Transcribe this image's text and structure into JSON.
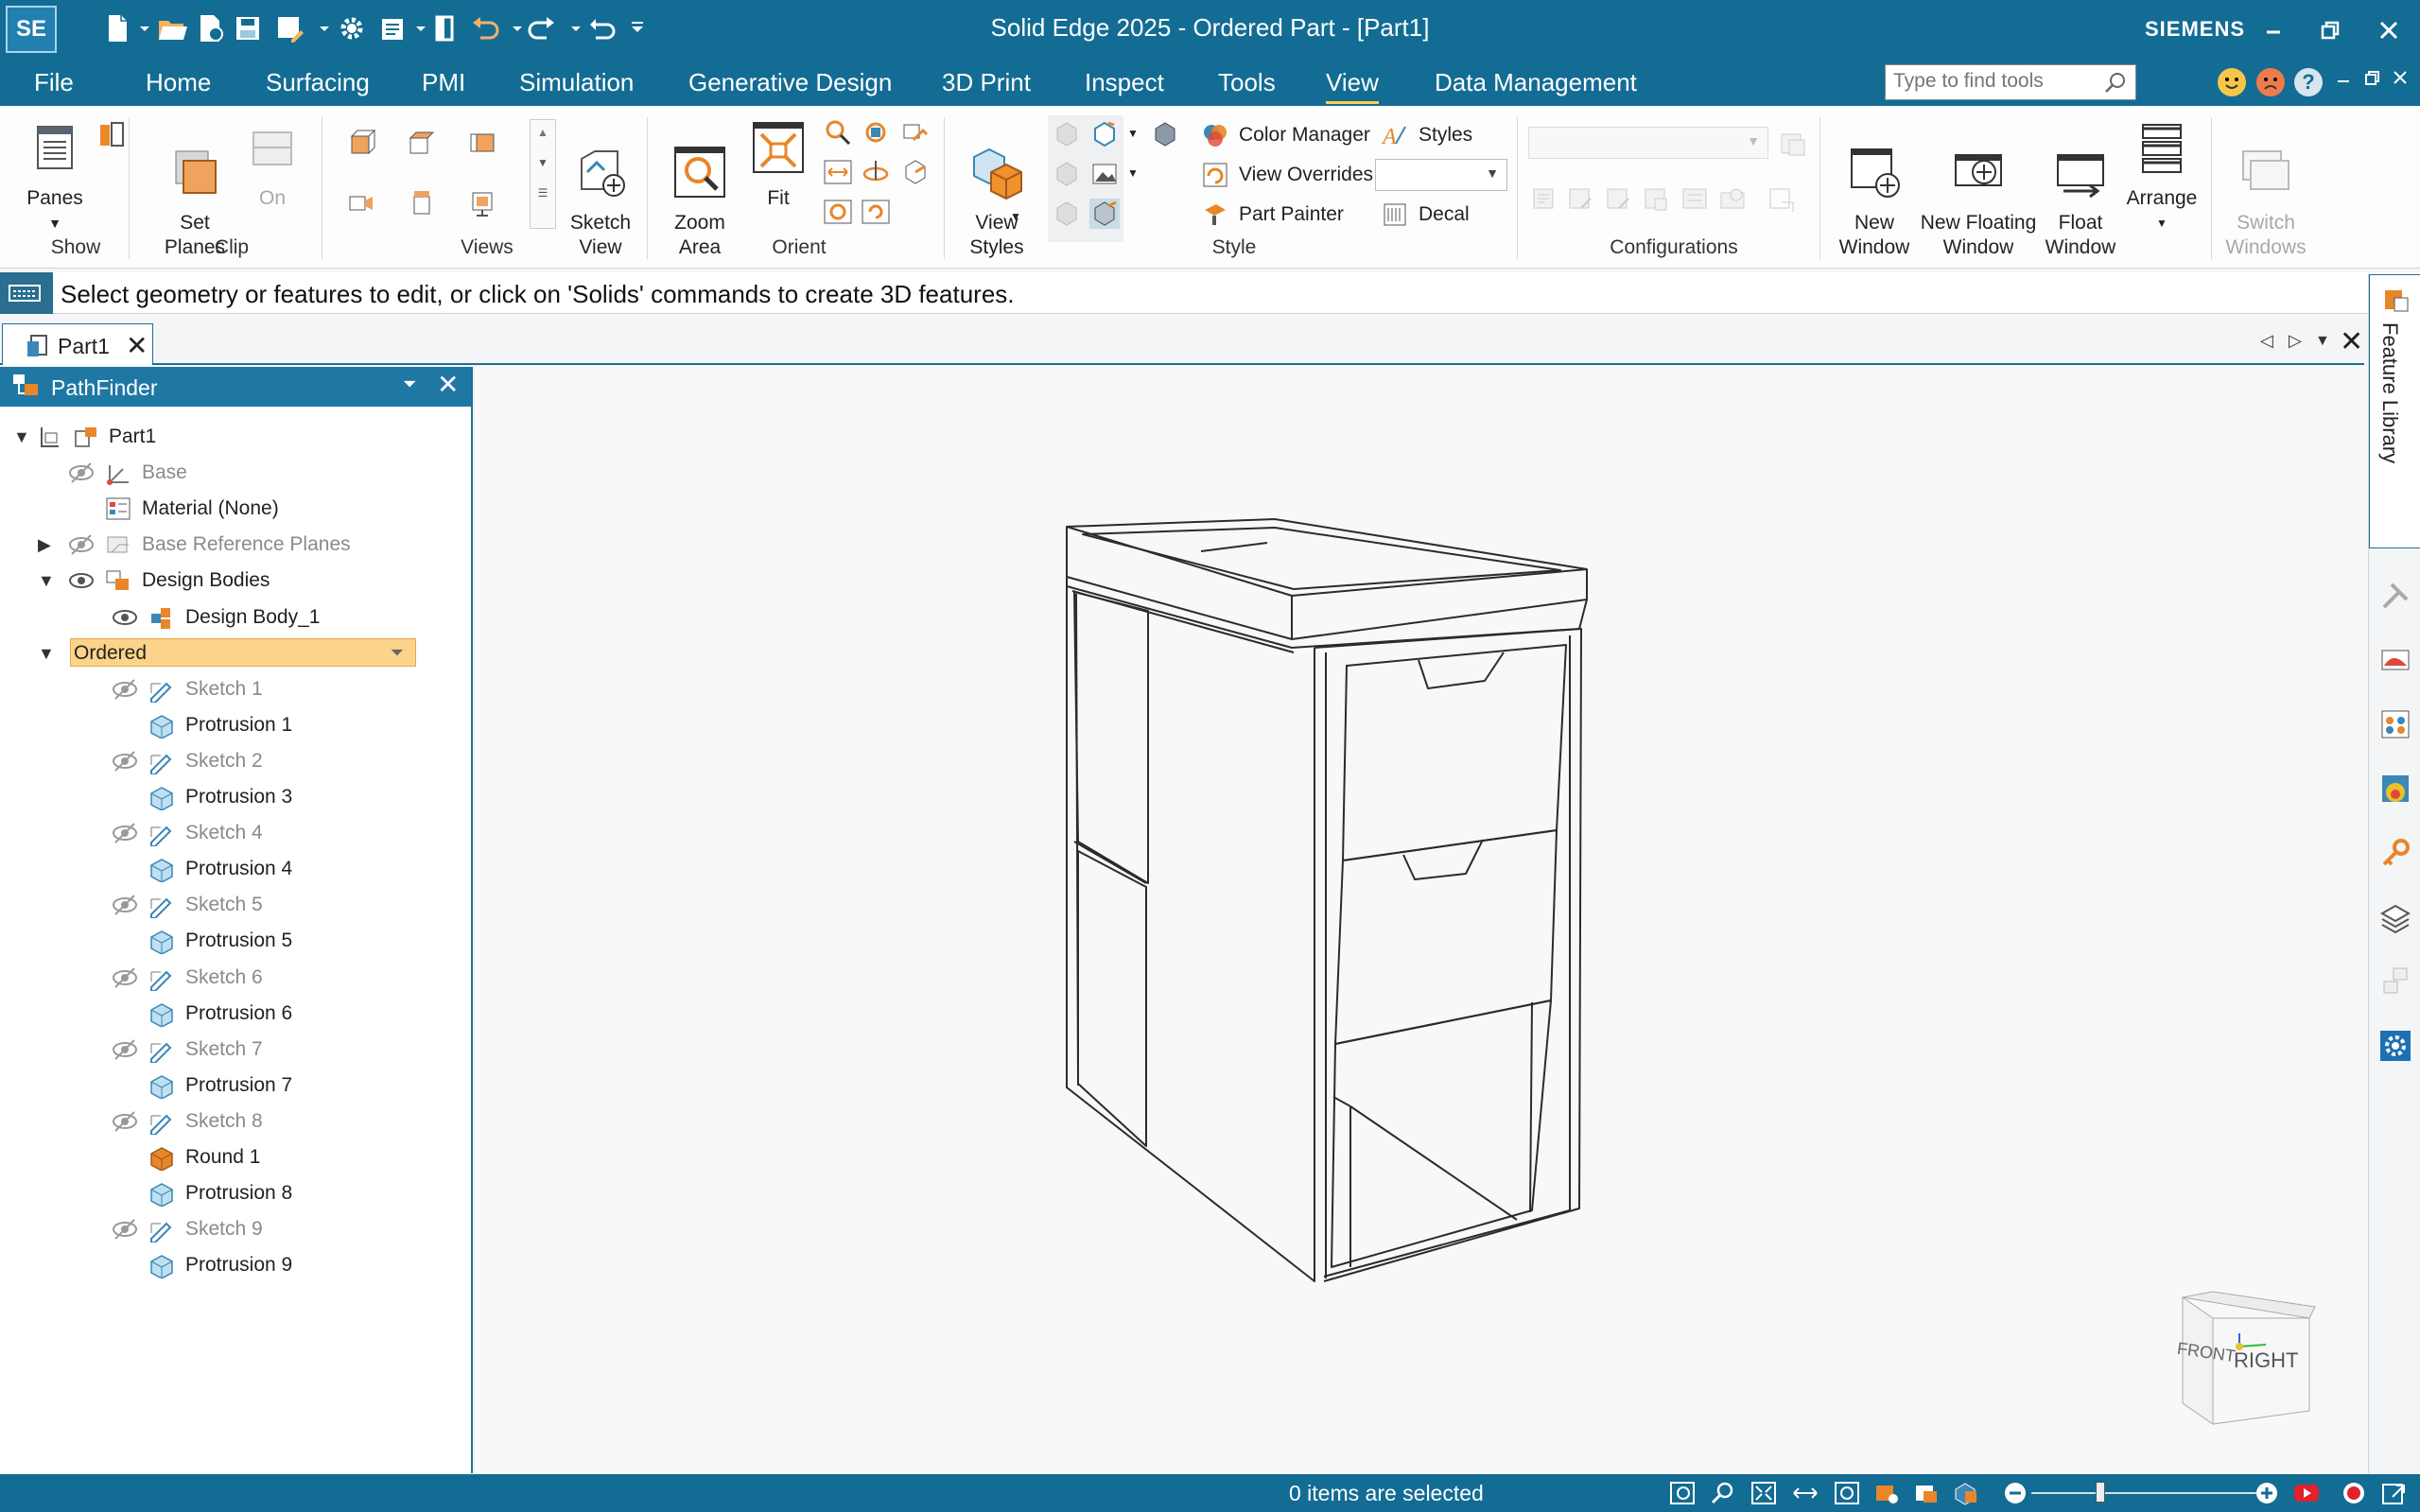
{
  "app": {
    "logo": "SE",
    "title": "Solid Edge 2025 - Ordered Part - [Part1]",
    "brand": "SIEMENS"
  },
  "menu": {
    "items": [
      "File",
      "Home",
      "Surfacing",
      "PMI",
      "Simulation",
      "Generative Design",
      "3D Print",
      "Inspect",
      "Tools",
      "View",
      "Data Management"
    ],
    "active": "View"
  },
  "search": {
    "placeholder": "Type to find tools"
  },
  "ribbon": {
    "show": {
      "label": "Show",
      "panes": "Panes"
    },
    "clip": {
      "label": "Clip",
      "set_planes": "Set\nPlanes",
      "on": "On"
    },
    "views": {
      "label": "Views",
      "sketch_view": "Sketch\nView"
    },
    "orient": {
      "label": "Orient",
      "zoom_area": "Zoom\nArea",
      "fit": "Fit"
    },
    "style": {
      "label": "Style",
      "view_styles": "View\nStyles",
      "color_manager": "Color Manager",
      "view_overrides": "View Overrides",
      "part_painter": "Part Painter",
      "styles": "Styles",
      "decal": "Decal"
    },
    "configurations": {
      "label": "Configurations"
    },
    "window": {
      "label": "Window",
      "new_window": "New\nWindow",
      "new_floating_window": "New Floating\nWindow",
      "float_window": "Float\nWindow",
      "arrange": "Arrange",
      "switch_windows": "Switch\nWindows"
    }
  },
  "prompt": {
    "text": "Select geometry or features to edit, or click on 'Solids' commands to create 3D features."
  },
  "doc_tab": {
    "label": "Part1"
  },
  "pathfinder": {
    "title": "PathFinder",
    "tree": [
      {
        "label": "Part1",
        "indent": 0,
        "toggle": "open",
        "eye": "none",
        "icon": "part-icon",
        "dim": false
      },
      {
        "label": "Base",
        "indent": 1,
        "toggle": "none",
        "eye": "hidden",
        "icon": "coordinate-system-icon",
        "dim": true
      },
      {
        "label": "Material (None)",
        "indent": 1,
        "toggle": "none",
        "eye": "none",
        "icon": "material-table-icon",
        "dim": false
      },
      {
        "label": "Base Reference Planes",
        "indent": 1,
        "toggle": "closed",
        "eye": "hidden",
        "icon": "reference-planes-icon",
        "dim": true
      },
      {
        "label": "Design Bodies",
        "indent": 1,
        "toggle": "open",
        "eye": "visible",
        "icon": "design-bodies-icon",
        "dim": false
      },
      {
        "label": "Design Body_1",
        "indent": 2,
        "toggle": "none",
        "eye": "visible",
        "icon": "design-body-icon",
        "dim": false
      },
      {
        "label": "Ordered",
        "indent": 1,
        "toggle": "open",
        "eye": "none",
        "icon": "none",
        "dim": false,
        "highlight": true
      },
      {
        "label": "Sketch 1",
        "indent": 2,
        "toggle": "none",
        "eye": "hidden",
        "icon": "sketch-icon",
        "dim": true
      },
      {
        "label": "Protrusion 1",
        "indent": 2,
        "toggle": "none",
        "eye": "none",
        "icon": "protrusion-icon",
        "dim": false
      },
      {
        "label": "Sketch 2",
        "indent": 2,
        "toggle": "none",
        "eye": "hidden",
        "icon": "sketch-icon",
        "dim": true
      },
      {
        "label": "Protrusion 3",
        "indent": 2,
        "toggle": "none",
        "eye": "none",
        "icon": "protrusion-icon",
        "dim": false
      },
      {
        "label": "Sketch 4",
        "indent": 2,
        "toggle": "none",
        "eye": "hidden",
        "icon": "sketch-icon",
        "dim": true
      },
      {
        "label": "Protrusion 4",
        "indent": 2,
        "toggle": "none",
        "eye": "none",
        "icon": "protrusion-icon",
        "dim": false
      },
      {
        "label": "Sketch 5",
        "indent": 2,
        "toggle": "none",
        "eye": "hidden",
        "icon": "sketch-icon",
        "dim": true
      },
      {
        "label": "Protrusion 5",
        "indent": 2,
        "toggle": "none",
        "eye": "none",
        "icon": "protrusion-icon",
        "dim": false
      },
      {
        "label": "Sketch 6",
        "indent": 2,
        "toggle": "none",
        "eye": "hidden",
        "icon": "sketch-icon",
        "dim": true
      },
      {
        "label": "Protrusion 6",
        "indent": 2,
        "toggle": "none",
        "eye": "none",
        "icon": "protrusion-icon",
        "dim": false
      },
      {
        "label": "Sketch 7",
        "indent": 2,
        "toggle": "none",
        "eye": "hidden",
        "icon": "sketch-icon",
        "dim": true
      },
      {
        "label": "Protrusion 7",
        "indent": 2,
        "toggle": "none",
        "eye": "none",
        "icon": "protrusion-icon",
        "dim": false
      },
      {
        "label": "Sketch 8",
        "indent": 2,
        "toggle": "none",
        "eye": "hidden",
        "icon": "sketch-icon",
        "dim": true
      },
      {
        "label": "Round 1",
        "indent": 2,
        "toggle": "none",
        "eye": "none",
        "icon": "round-icon",
        "dim": false
      },
      {
        "label": "Protrusion 8",
        "indent": 2,
        "toggle": "none",
        "eye": "none",
        "icon": "protrusion-icon",
        "dim": false
      },
      {
        "label": "Sketch 9",
        "indent": 2,
        "toggle": "none",
        "eye": "hidden",
        "icon": "sketch-icon",
        "dim": true
      },
      {
        "label": "Protrusion 9",
        "indent": 2,
        "toggle": "none",
        "eye": "none",
        "icon": "protrusion-icon",
        "dim": false
      }
    ]
  },
  "view_cube": {
    "front": "FRONT",
    "right": "RIGHT"
  },
  "right_dock": {
    "feature_library": "Feature Library"
  },
  "status": {
    "text": "0 items are selected"
  },
  "colors": {
    "brand_blue": "#136c94",
    "highlight": "#fcd38a",
    "orange": "#e8862a"
  }
}
